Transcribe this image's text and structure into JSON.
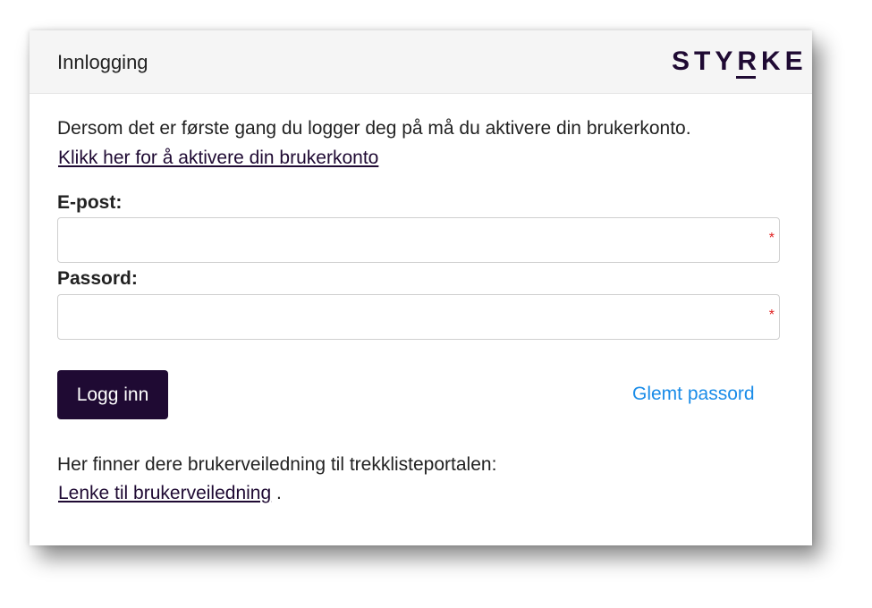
{
  "header": {
    "title": "Innlogging",
    "logo_text": "STYRKE"
  },
  "intro": {
    "text": "Dersom det er første gang du logger deg på må du aktivere din brukerkonto.",
    "activate_link": "Klikk her for å aktivere din brukerkonto"
  },
  "form": {
    "email_label": "E-post:",
    "email_value": "",
    "email_required_marker": "*",
    "password_label": "Passord:",
    "password_value": "",
    "password_required_marker": "*",
    "login_button": "Logg inn",
    "forgot_link": "Glemt passord"
  },
  "guide": {
    "text": "Her finner dere brukerveiledning til trekklisteportalen:",
    "link": "Lenke til brukerveiledning",
    "suffix": " ."
  },
  "colors": {
    "brand": "#1f0a33",
    "link_blue": "#1a8ce8",
    "required": "#e02020",
    "header_bg": "#f5f5f5"
  }
}
